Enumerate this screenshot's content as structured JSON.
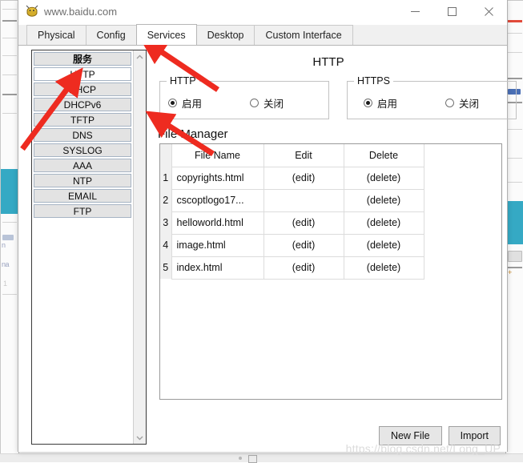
{
  "window": {
    "title": "www.baidu.com",
    "icon": "packet-tracer-device-icon",
    "minimize": "–",
    "maximize": "□",
    "close": "✕"
  },
  "tabs": [
    {
      "label": "Physical",
      "active": false
    },
    {
      "label": "Config",
      "active": false
    },
    {
      "label": "Services",
      "active": true
    },
    {
      "label": "Desktop",
      "active": false
    },
    {
      "label": "Custom Interface",
      "active": false
    }
  ],
  "sidebar": {
    "scrollbar": {
      "up": "⌃",
      "down": "⌄"
    },
    "items": [
      {
        "label": "服务",
        "header": true,
        "selected": false
      },
      {
        "label": "HTTP",
        "header": false,
        "selected": true
      },
      {
        "label": "DHCP",
        "header": false,
        "selected": false
      },
      {
        "label": "DHCPv6",
        "header": false,
        "selected": false
      },
      {
        "label": "TFTP",
        "header": false,
        "selected": false
      },
      {
        "label": "DNS",
        "header": false,
        "selected": false
      },
      {
        "label": "SYSLOG",
        "header": false,
        "selected": false
      },
      {
        "label": "AAA",
        "header": false,
        "selected": false
      },
      {
        "label": "NTP",
        "header": false,
        "selected": false
      },
      {
        "label": "EMAIL",
        "header": false,
        "selected": false
      },
      {
        "label": "FTP",
        "header": false,
        "selected": false
      }
    ]
  },
  "main": {
    "page_title": "HTTP",
    "http_group": {
      "legend": "HTTP",
      "on_label": "启用",
      "off_label": "关闭",
      "selected": "on"
    },
    "https_group": {
      "legend": "HTTPS",
      "on_label": "启用",
      "off_label": "关闭",
      "selected": "on"
    },
    "file_manager": {
      "title": "File Manager",
      "columns": [
        "File Name",
        "Edit",
        "Delete"
      ],
      "rows": [
        {
          "num": "1",
          "name": "copyrights.html",
          "edit": "(edit)",
          "delete": "(delete)"
        },
        {
          "num": "2",
          "name": "cscoptlogo17...",
          "edit": "",
          "delete": "(delete)"
        },
        {
          "num": "3",
          "name": "helloworld.html",
          "edit": "(edit)",
          "delete": "(delete)"
        },
        {
          "num": "4",
          "name": "image.html",
          "edit": "(edit)",
          "delete": "(delete)"
        },
        {
          "num": "5",
          "name": "index.html",
          "edit": "(edit)",
          "delete": "(delete)"
        }
      ]
    },
    "buttons": {
      "new_file": "New File",
      "import": "Import"
    }
  },
  "watermark": "https://blog.csdn.net/Long_UP",
  "annotations": {
    "arrow_color": "#ee2b20",
    "arrows": [
      {
        "name": "arrow-to-services-tab",
        "from": [
          272,
          112
        ],
        "to": [
          186,
          54
        ]
      },
      {
        "name": "arrow-to-http-sidebar-item",
        "from": [
          28,
          186
        ],
        "to": [
          93,
          100
        ]
      },
      {
        "name": "arrow-to-http-enable-radio",
        "from": [
          263,
          189
        ],
        "to": [
          197,
          148
        ]
      }
    ]
  },
  "colors": {
    "accent_selected": "#35a9c4",
    "arrow_red": "#ee2b20",
    "list_item_bg": "#e3e3e3",
    "list_item_border": "#a6b4c4",
    "button_bg": "#e6e6e6",
    "watermark": "#dcdcdc"
  }
}
